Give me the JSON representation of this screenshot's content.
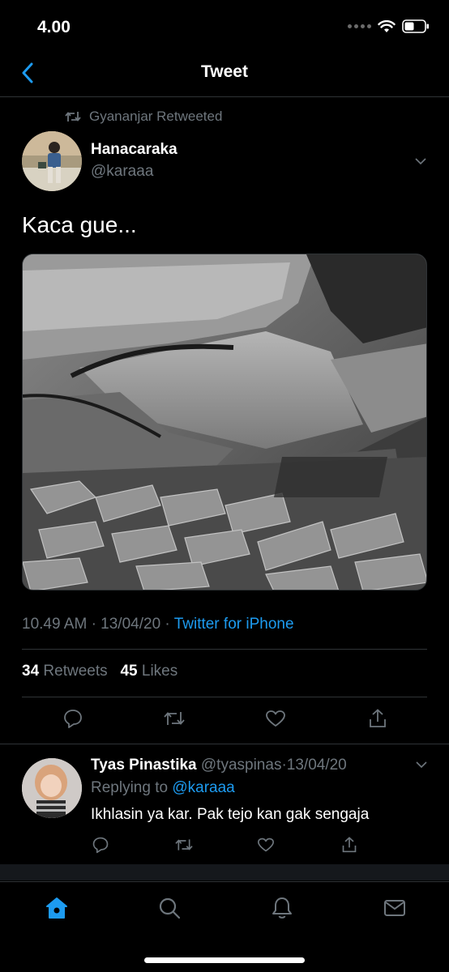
{
  "status_bar": {
    "time": "4.00"
  },
  "nav": {
    "title": "Tweet"
  },
  "retweet": {
    "text": "Gyananjar Retweeted"
  },
  "tweet": {
    "author_name": "Hanacaraka",
    "author_handle": "@karaaa",
    "text": "Kaca gue...",
    "time": "10.49 AM",
    "date": "13/04/20",
    "separator": "·",
    "source": "Twitter for iPhone",
    "retweets_count": "34",
    "retweets_label": "Retweets",
    "likes_count": "45",
    "likes_label": "Likes"
  },
  "reply": {
    "name": "Tyas Pinastika",
    "handle": "@tyaspinas",
    "separator": "·",
    "date": "13/04/20",
    "replying_label": "Replying to",
    "replying_mention": "@karaaa",
    "text": "Ikhlasin ya kar. Pak tejo kan gak sengaja"
  },
  "colors": {
    "background": "#000000",
    "accent": "#1d9bf0",
    "secondary_text": "#6e767d",
    "divider": "#2f3336"
  },
  "icons": {
    "back": "chevron-left-icon",
    "retweet": "retweet-icon",
    "reply": "reply-icon",
    "like": "heart-icon",
    "share": "share-icon",
    "caret": "chevron-down-icon",
    "tabs": [
      "home-icon",
      "search-icon",
      "bell-icon",
      "mail-icon"
    ]
  }
}
